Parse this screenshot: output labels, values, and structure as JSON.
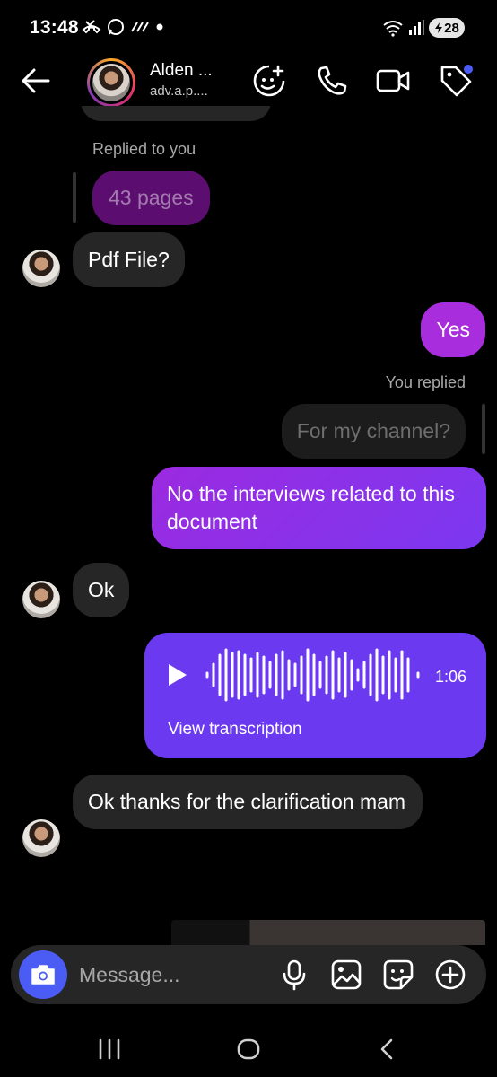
{
  "status": {
    "time": "13:48",
    "battery": "28"
  },
  "header": {
    "name": "Alden ...",
    "handle": "adv.a.p...."
  },
  "messages": {
    "replied_to_you": "Replied to you",
    "quoted_pages": "43 pages",
    "pdf_file": "Pdf File?",
    "yes": "Yes",
    "you_replied": "You replied",
    "quoted_channel": "For my channel?",
    "interviews": "No the interviews related to this document",
    "ok": "Ok",
    "voice_duration": "1:06",
    "view_transcription": "View transcription",
    "thanks": "Ok thanks for the clarification mam"
  },
  "composer": {
    "placeholder": "Message..."
  },
  "colors": {
    "accent_purple": "#8d2ee6",
    "outgoing_gradient_start": "#b527d6",
    "outgoing_gradient_end": "#6a3cf3",
    "incoming_bubble": "#262626",
    "camera_blue": "#4b5cf5"
  }
}
